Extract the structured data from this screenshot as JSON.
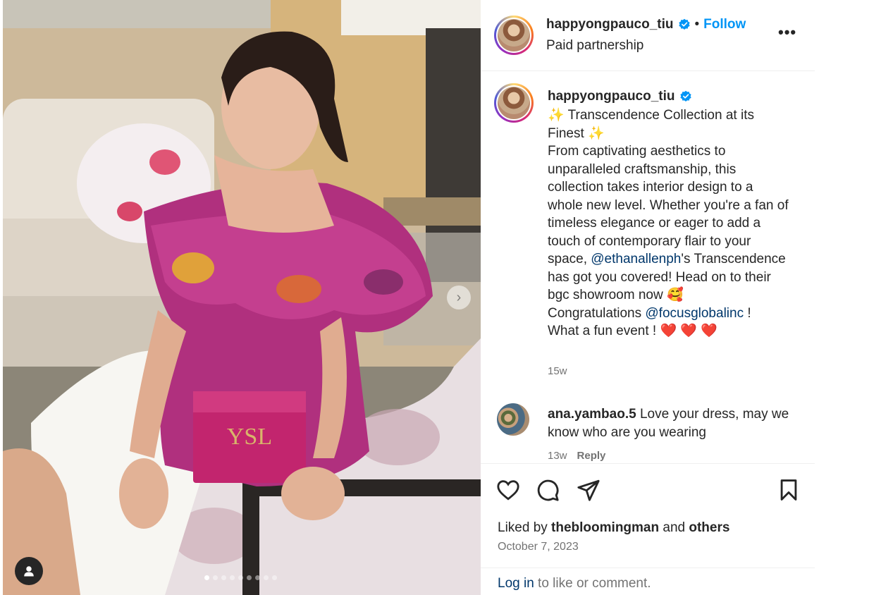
{
  "post": {
    "author": "happyongpauco_tiu",
    "separator": "•",
    "follow_label": "Follow",
    "subtitle": "Paid partnership",
    "more_label": "•••"
  },
  "caption": {
    "author": "happyongpauco_tiu",
    "line1": "✨ Transcendence Collection at its Finest ✨",
    "line2": "From captivating aesthetics to unparalleled craftsmanship, this collection takes interior design to a whole new level. Whether you're a fan of timeless elegance or eager to add a touch of contemporary flair to your space, ",
    "mention1": "@ethanallenph",
    "line2b": "'s Transcendence has got you covered! Head on to their bgc showroom now 🥰",
    "line3_prefix": "Congratulations ",
    "mention2": "@focusglobalinc",
    "line3_suffix": " !",
    "line4": "What a fun event ! ❤️ ❤️ ❤️",
    "time": "15w"
  },
  "comment": {
    "user": "ana.yambao.5",
    "text": " Love your dress, may we know who are you wearing",
    "time": "13w",
    "reply_label": "Reply"
  },
  "likes": {
    "prefix": "Liked by ",
    "user": "thebloomingman",
    "middle": " and ",
    "others": "others"
  },
  "date": "October 7, 2023",
  "login": {
    "link": "Log in",
    "rest": " to like or comment."
  },
  "carousel": {
    "slide_count": 9,
    "active_index": 0,
    "next_label": "›"
  },
  "colors": {
    "link": "#0095f6",
    "mention": "#00376b",
    "muted": "#737373",
    "verified": "#0095f6"
  }
}
